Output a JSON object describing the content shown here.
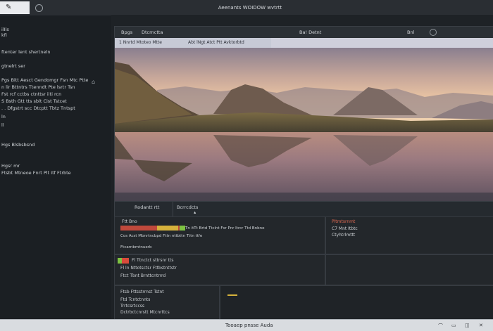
{
  "colors": {
    "accent_red": "#d94a3a",
    "accent_green": "#7ec242",
    "accent_yellow": "#d6b23c",
    "panel_bg": "#23272b",
    "status_bg": "#d9dce0"
  },
  "topbar": {
    "logo_glyph": "✎",
    "title": "Aeenants WOIDOW wvtrtt"
  },
  "sidebar": {
    "lines": [
      "ilIls",
      "kfi",
      "ftenter lent shertneln",
      "gtnelrt ser",
      "Pgs Bitt Aesct Gendomgr  Fsn Mtc  Ptte",
      "n  lir  Bttntrs Ttenndt  Pte  lsrtr  Tsn",
      "Fst  rcf cctbs  ctnttsr  iiti   rcn",
      "S  Bsth  Gtt tts   sblt   Cist  Tstcet",
      ". .  Dfgstrt  scc  Dtcptt   Tbtz  Tntspt",
      "ln",
      "ll",
      "Hgs Blsbsbsnd",
      "Hgsr mr",
      "Ftsbt  Mtneoe  Fnrt  Plt  Itf  Ftrbte"
    ]
  },
  "main": {
    "header_left": "Bpgs",
    "header_tab": "Dtcrnctta",
    "header_mid": "Ba! Detnt",
    "header_right": "Bnl",
    "strip_left": "1  Nnrtd  Mtoteo  Mtte",
    "strip_right": "Abt lNgt  Atct  Ptt  Avktorbtd",
    "footer_left": "Rodantt rtt",
    "footer_right": "Bcrrcdcts",
    "footer_cursor": "▴"
  },
  "panels": {
    "p1_title": "Ftt   Bno",
    "p1_row": "Tn  itTt  Brtd  Ttclnt  Fsr  Pnr  Itrcr  Ttd  Bnbne",
    "p1_row2": "Cos Acst  Mbnrtncbpd  Fttn  nttbttn  Tttn  ttfe",
    "p1_row3": "Ftcarnbmtnuerb",
    "p2_title": "Pltmtsrnmt",
    "p2_row": "C7  Mnt  Itbtc",
    "p2_row2": "Ctyhtrlmttt",
    "p3_title": "Fl Ttnctct  sttrsnr  tts",
    "p3_row": "Fl ln  Nttotsctsr  Fttbstnttstr",
    "p3_row2": "Ftct  Tbnt  Brnttcntrrrd",
    "p5_title": "Ftsb  Fttsstrrnst   Tstnt",
    "p5_row": "Ftd  Tcntctnnts",
    "p5_row2": "Trrtcsrtccss",
    "p5_row3": "Dctrbctcnrstt  Mtcnrttcs"
  },
  "status": {
    "text": "Tooaep pnsse Auda",
    "icons": [
      "⌒",
      "▭",
      "◫",
      "✕"
    ]
  }
}
